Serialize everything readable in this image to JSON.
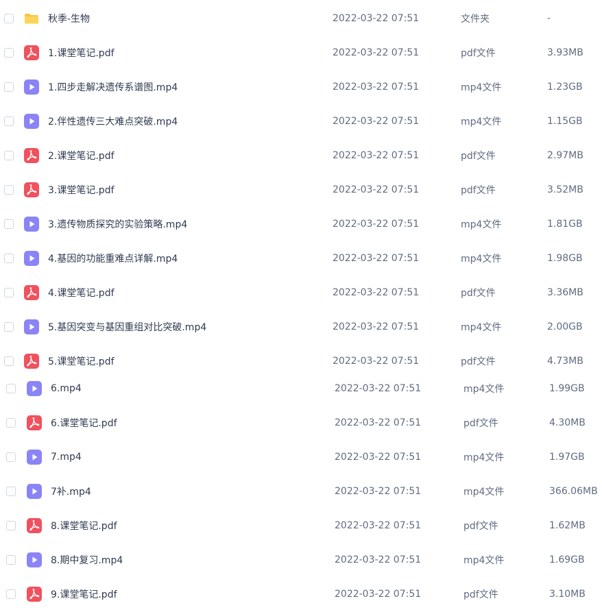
{
  "colors": {
    "folder": "#f9c63d",
    "pdf": "#f0515e",
    "video": "#8a84f6",
    "text_primary": "#2f3a50",
    "text_secondary": "#5f6b80",
    "checkbox_border": "#cfd6e2"
  },
  "files": [
    {
      "name": "秋季-生物",
      "date": "2022-03-22 07:51",
      "type": "文件夹",
      "size": "-",
      "icon": "folder-icon"
    },
    {
      "name": "1.课堂笔记.pdf",
      "date": "2022-03-22 07:51",
      "type": "pdf文件",
      "size": "3.93MB",
      "icon": "pdf-icon"
    },
    {
      "name": "1.四步走解决遗传系谱图.mp4",
      "date": "2022-03-22 07:51",
      "type": "mp4文件",
      "size": "1.23GB",
      "icon": "video-icon"
    },
    {
      "name": "2.伴性遗传三大难点突破.mp4",
      "date": "2022-03-22 07:51",
      "type": "mp4文件",
      "size": "1.15GB",
      "icon": "video-icon"
    },
    {
      "name": "2.课堂笔记.pdf",
      "date": "2022-03-22 07:51",
      "type": "pdf文件",
      "size": "2.97MB",
      "icon": "pdf-icon"
    },
    {
      "name": "3.课堂笔记.pdf",
      "date": "2022-03-22 07:51",
      "type": "pdf文件",
      "size": "3.52MB",
      "icon": "pdf-icon"
    },
    {
      "name": "3.遗传物质探究的实验策略.mp4",
      "date": "2022-03-22 07:51",
      "type": "mp4文件",
      "size": "1.81GB",
      "icon": "video-icon"
    },
    {
      "name": "4.基因的功能重难点详解.mp4",
      "date": "2022-03-22 07:51",
      "type": "mp4文件",
      "size": "1.98GB",
      "icon": "video-icon"
    },
    {
      "name": "4.课堂笔记.pdf",
      "date": "2022-03-22 07:51",
      "type": "pdf文件",
      "size": "3.36MB",
      "icon": "pdf-icon"
    },
    {
      "name": "5.基因突变与基因重组对比突破.mp4",
      "date": "2022-03-22 07:51",
      "type": "mp4文件",
      "size": "2.00GB",
      "icon": "video-icon"
    },
    {
      "name": "5.课堂笔记.pdf",
      "date": "2022-03-22 07:51",
      "type": "pdf文件",
      "size": "4.73MB",
      "icon": "pdf-icon"
    },
    {
      "name": "6.mp4",
      "date": "2022-03-22 07:51",
      "type": "mp4文件",
      "size": "1.99GB",
      "icon": "video-icon"
    },
    {
      "name": "6.课堂笔记.pdf",
      "date": "2022-03-22 07:51",
      "type": "pdf文件",
      "size": "4.30MB",
      "icon": "pdf-icon"
    },
    {
      "name": "7.mp4",
      "date": "2022-03-22 07:51",
      "type": "mp4文件",
      "size": "1.97GB",
      "icon": "video-icon"
    },
    {
      "name": "7补.mp4",
      "date": "2022-03-22 07:51",
      "type": "mp4文件",
      "size": "366.06MB",
      "icon": "video-icon"
    },
    {
      "name": "8.课堂笔记.pdf",
      "date": "2022-03-22 07:51",
      "type": "pdf文件",
      "size": "1.62MB",
      "icon": "pdf-icon"
    },
    {
      "name": "8.期中复习.mp4",
      "date": "2022-03-22 07:51",
      "type": "mp4文件",
      "size": "1.69GB",
      "icon": "video-icon"
    },
    {
      "name": "9.课堂笔记.pdf",
      "date": "2022-03-22 07:51",
      "type": "pdf文件",
      "size": "3.10MB",
      "icon": "pdf-icon"
    }
  ]
}
